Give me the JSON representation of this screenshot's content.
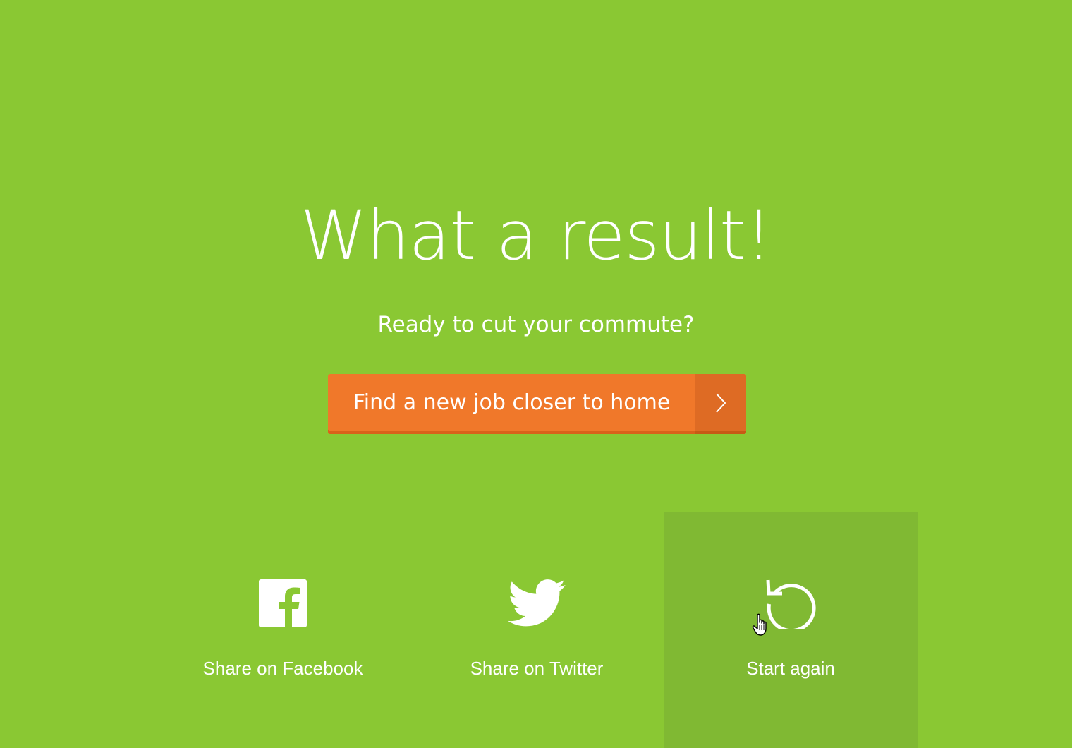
{
  "result": {
    "headline": "What a result!",
    "subheadline": "Ready to cut your commute?"
  },
  "cta": {
    "label": "Find a new job closer to home",
    "arrow_icon": "chevron-right-icon"
  },
  "actions": [
    {
      "label": "Share on Facebook",
      "icon": "facebook-icon"
    },
    {
      "label": "Share on Twitter",
      "icon": "twitter-icon"
    },
    {
      "label": "Start again",
      "icon": "restart-icon",
      "state": "hovered"
    }
  ],
  "colors": {
    "background": "#8ac833",
    "cta": "#f0782a",
    "cta_arrow": "#de6b24",
    "hover_tile": "#80b933",
    "text": "#ffffff"
  }
}
